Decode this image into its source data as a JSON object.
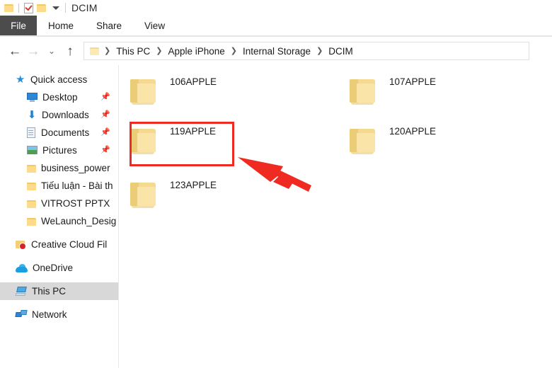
{
  "window": {
    "title": "DCIM",
    "quick_access_toolbar": [
      {
        "name": "folder-icon",
        "label": "Folder"
      },
      {
        "name": "properties-icon",
        "label": "Properties"
      },
      {
        "name": "new-folder-icon",
        "label": "New folder"
      },
      {
        "name": "customize-qat-icon",
        "label": "Customize Quick Access Toolbar"
      }
    ]
  },
  "ribbon": {
    "tabs": [
      {
        "label": "File",
        "active": true
      },
      {
        "label": "Home",
        "active": false
      },
      {
        "label": "Share",
        "active": false
      },
      {
        "label": "View",
        "active": false
      }
    ]
  },
  "navigation": {
    "back_icon": "←",
    "forward_icon": "→",
    "recent_icon": "⌄",
    "up_icon": "↑",
    "breadcrumbs": [
      "This PC",
      "Apple iPhone",
      "Internal Storage",
      "DCIM"
    ],
    "separator": "❯"
  },
  "sidebar": {
    "items": [
      {
        "label": "Quick access",
        "icon": "star-icon",
        "indent": false,
        "pinned": false,
        "selected": false
      },
      {
        "label": "Desktop",
        "icon": "desktop-icon",
        "indent": true,
        "pinned": true,
        "selected": false
      },
      {
        "label": "Downloads",
        "icon": "download-icon",
        "indent": true,
        "pinned": true,
        "selected": false
      },
      {
        "label": "Documents",
        "icon": "document-icon",
        "indent": true,
        "pinned": true,
        "selected": false
      },
      {
        "label": "Pictures",
        "icon": "pictures-icon",
        "indent": true,
        "pinned": true,
        "selected": false
      },
      {
        "label": "business_power",
        "icon": "folder-icon",
        "indent": true,
        "pinned": false,
        "selected": false
      },
      {
        "label": "Tiếu luận - Bài th",
        "icon": "folder-icon",
        "indent": true,
        "pinned": false,
        "selected": false
      },
      {
        "label": "VITROST PPTX",
        "icon": "folder-icon",
        "indent": true,
        "pinned": false,
        "selected": false
      },
      {
        "label": "WeLaunch_Desig",
        "icon": "folder-icon",
        "indent": true,
        "pinned": false,
        "selected": false
      },
      {
        "label": "Creative Cloud Fil",
        "icon": "creative-cloud-icon",
        "indent": false,
        "pinned": false,
        "selected": false
      },
      {
        "label": "OneDrive",
        "icon": "onedrive-icon",
        "indent": false,
        "pinned": false,
        "selected": false
      },
      {
        "label": "This PC",
        "icon": "this-pc-icon",
        "indent": false,
        "pinned": false,
        "selected": true
      },
      {
        "label": "Network",
        "icon": "network-icon",
        "indent": false,
        "pinned": false,
        "selected": false
      }
    ],
    "pin_glyph": "📌"
  },
  "content": {
    "folders": [
      {
        "name": "106APPLE",
        "col": 0,
        "row": 0,
        "highlighted": false
      },
      {
        "name": "107APPLE",
        "col": 1,
        "row": 0,
        "highlighted": false
      },
      {
        "name": "119APPLE",
        "col": 0,
        "row": 1,
        "highlighted": true
      },
      {
        "name": "120APPLE",
        "col": 1,
        "row": 1,
        "highlighted": false
      },
      {
        "name": "123APPLE",
        "col": 0,
        "row": 2,
        "highlighted": false
      }
    ]
  },
  "annotations": {
    "highlight_color": "#ef2a21",
    "arrow_color": "#ef2a21",
    "highlight_target": "119APPLE"
  }
}
